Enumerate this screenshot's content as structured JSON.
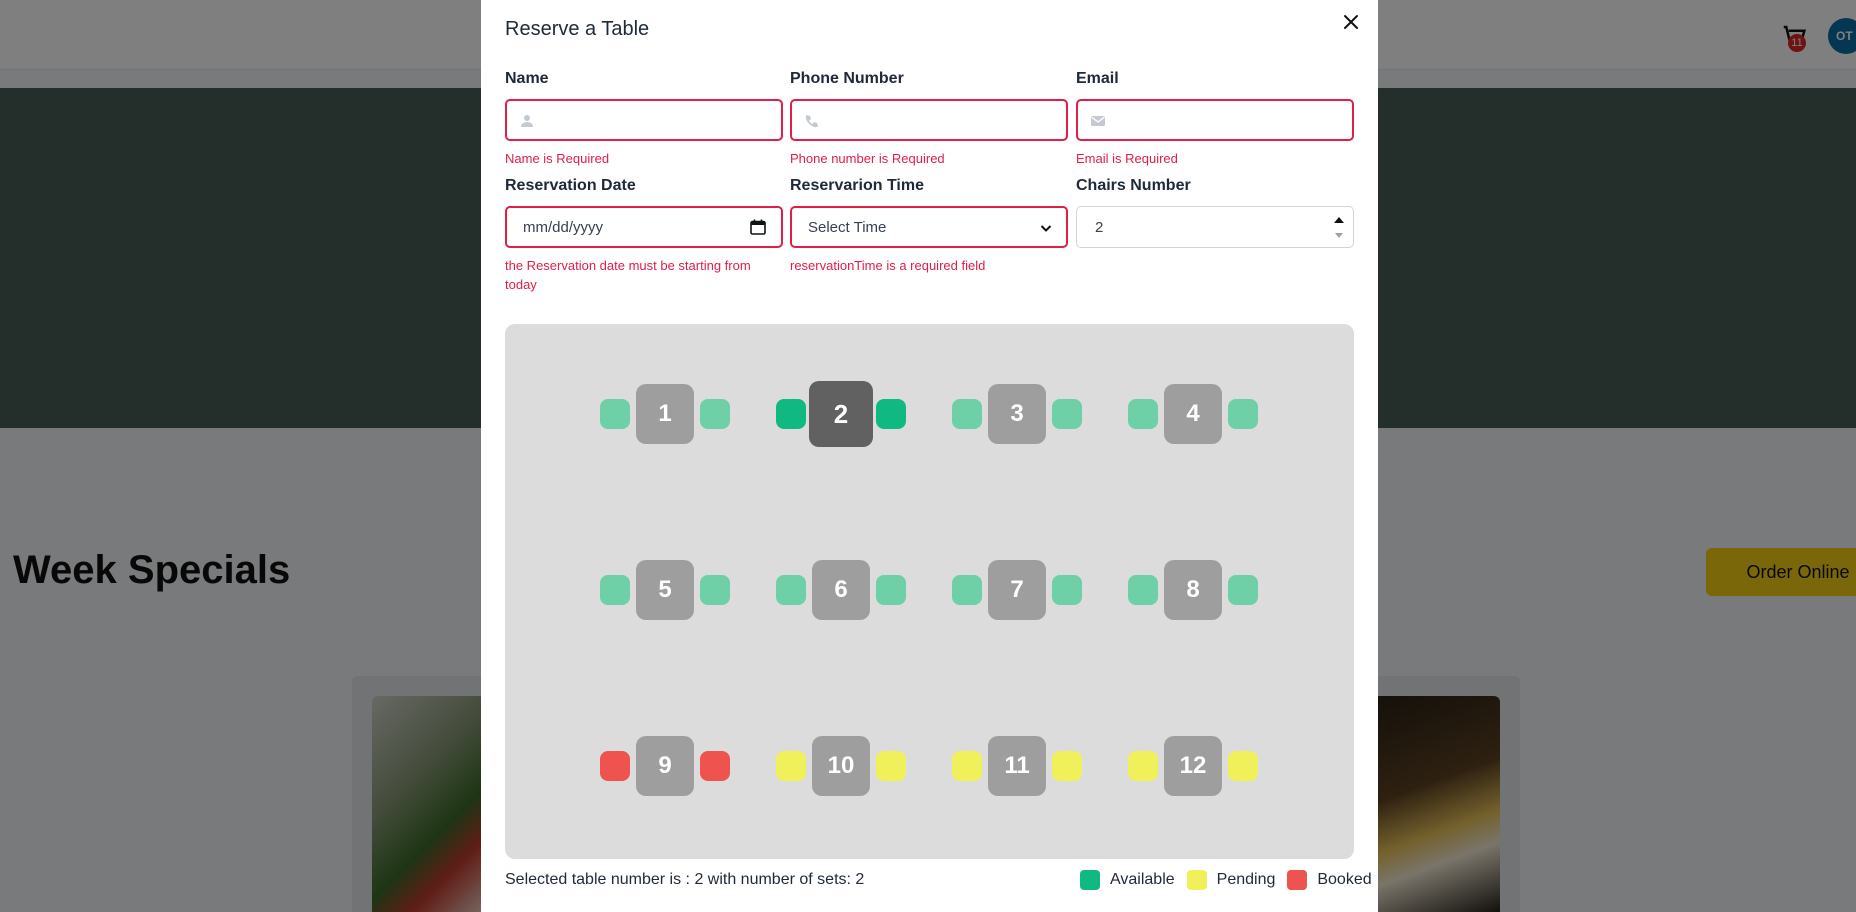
{
  "background": {
    "cart_count": "11",
    "avatar_initials": "OT",
    "section_title": "Week Specials",
    "order_button": "Order Online"
  },
  "modal": {
    "title": "Reserve a Table",
    "fields": {
      "name": {
        "label": "Name",
        "value": "",
        "error": "Name is Required"
      },
      "phone": {
        "label": "Phone Number",
        "value": "",
        "error": "Phone number is Required"
      },
      "email": {
        "label": "Email",
        "value": "",
        "error": "Email is Required"
      },
      "date": {
        "label": "Reservation Date",
        "placeholder": "mm/dd/yyyy",
        "error": "the Reservation date must be starting from today"
      },
      "time": {
        "label": "Reservarion Time",
        "selected": "Select Time",
        "error": "reservationTime is a required field"
      },
      "chairs": {
        "label": "Chairs Number",
        "value": "2"
      }
    },
    "tables": [
      {
        "number": "1",
        "status": "available",
        "selected": false
      },
      {
        "number": "2",
        "status": "available",
        "selected": true
      },
      {
        "number": "3",
        "status": "available",
        "selected": false
      },
      {
        "number": "4",
        "status": "available",
        "selected": false
      },
      {
        "number": "5",
        "status": "available",
        "selected": false
      },
      {
        "number": "6",
        "status": "available",
        "selected": false
      },
      {
        "number": "7",
        "status": "available",
        "selected": false
      },
      {
        "number": "8",
        "status": "available",
        "selected": false
      },
      {
        "number": "9",
        "status": "booked",
        "selected": false
      },
      {
        "number": "10",
        "status": "pending",
        "selected": false
      },
      {
        "number": "11",
        "status": "pending",
        "selected": false
      },
      {
        "number": "12",
        "status": "pending",
        "selected": false
      }
    ],
    "footer_text": "Selected table number is : 2 with number of sets: 2",
    "legend": [
      {
        "label": "Available",
        "color": "#10b981"
      },
      {
        "label": "Pending",
        "color": "#f0f05a"
      },
      {
        "label": "Booked",
        "color": "#ef5350"
      }
    ],
    "colors": {
      "available": "#6fcfa7",
      "available_selected": "#10b981",
      "pending": "#f0f05a",
      "booked": "#ef5350"
    }
  }
}
